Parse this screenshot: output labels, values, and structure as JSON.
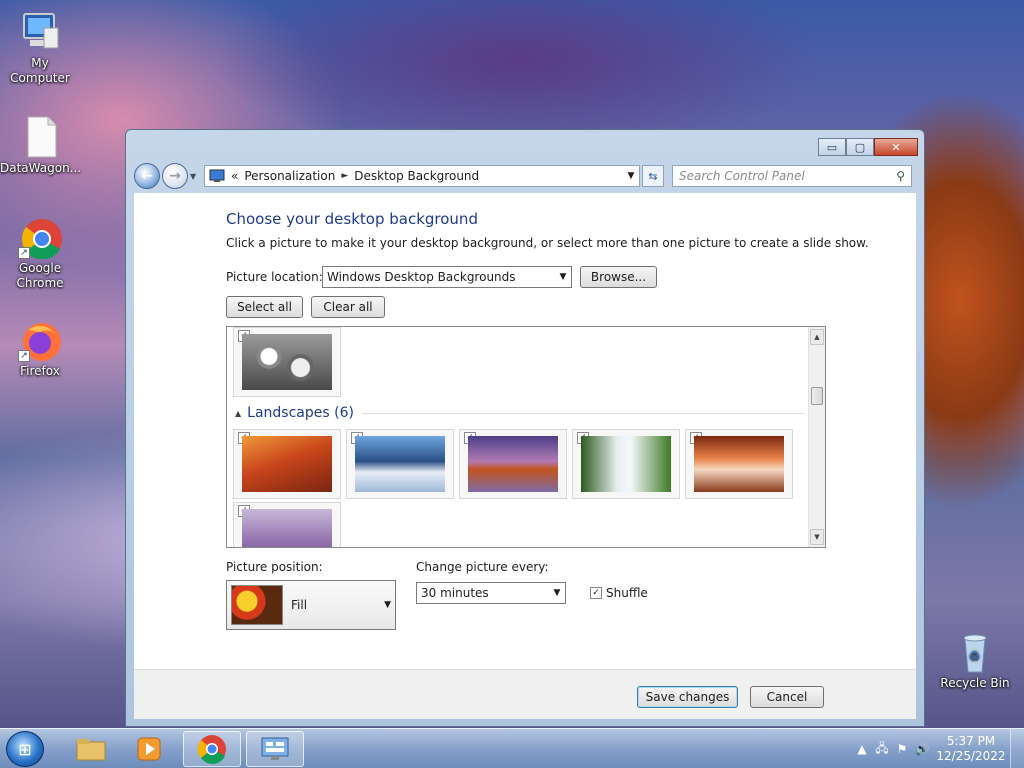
{
  "desktop": {
    "icons": [
      {
        "label": "My Computer"
      },
      {
        "label": "DataWagon..."
      },
      {
        "label": "Google Chrome"
      },
      {
        "label": "Firefox"
      },
      {
        "label": "Recycle Bin"
      }
    ]
  },
  "window": {
    "caption": {
      "minimize": "▭",
      "maximize": "▢",
      "close": "✕"
    },
    "nav": {
      "back_icon": "back-arrow-icon",
      "breadcrumb_prefix": "«",
      "breadcrumb": [
        "Personalization",
        "Desktop Background"
      ],
      "separator": "►",
      "search_placeholder": "Search Control Panel"
    },
    "title": "Choose your desktop background",
    "description": "Click a picture to make it your desktop background, or select more than one picture to create a slide show.",
    "picture_location_label": "Picture location:",
    "picture_location_value": "Windows Desktop Backgrounds",
    "browse_label": "Browse...",
    "select_all_label": "Select all",
    "clear_all_label": "Clear all",
    "gallery": {
      "group_name": "Landscapes (6)",
      "check": "✓"
    },
    "picture_position_label": "Picture position:",
    "picture_position_value": "Fill",
    "change_every_label": "Change picture every:",
    "change_every_value": "30 minutes",
    "shuffle_label": "Shuffle",
    "save_label": "Save changes",
    "cancel_label": "Cancel"
  },
  "taskbar": {
    "clock_time": "5:37 PM",
    "clock_date": "12/25/2022"
  }
}
